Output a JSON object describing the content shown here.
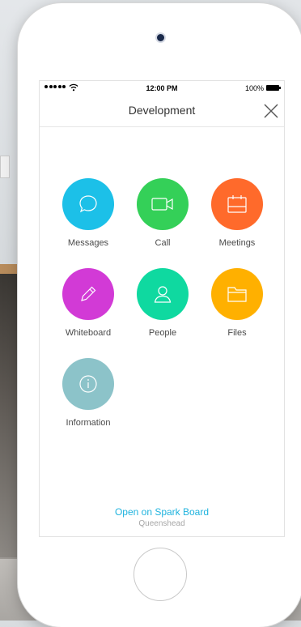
{
  "status_bar": {
    "time": "12:00 PM",
    "battery": "100%"
  },
  "nav": {
    "title": "Development",
    "close_icon": "close-icon"
  },
  "tiles": [
    {
      "label": "Messages",
      "icon": "chat-bubble-icon",
      "color": "#1cc0e8"
    },
    {
      "label": "Call",
      "icon": "video-camera-icon",
      "color": "#34d058"
    },
    {
      "label": "Meetings",
      "icon": "calendar-icon",
      "color": "#ff6a2b"
    },
    {
      "label": "Whiteboard",
      "icon": "pencil-icon",
      "color": "#d23ad6"
    },
    {
      "label": "People",
      "icon": "person-icon",
      "color": "#0fd9a0"
    },
    {
      "label": "Files",
      "icon": "folder-icon",
      "color": "#ffb000"
    },
    {
      "label": "Information",
      "icon": "info-icon",
      "color": "#8cc3c9"
    }
  ],
  "footer": {
    "link": "Open on Spark Board",
    "subtitle": "Queenshead"
  }
}
